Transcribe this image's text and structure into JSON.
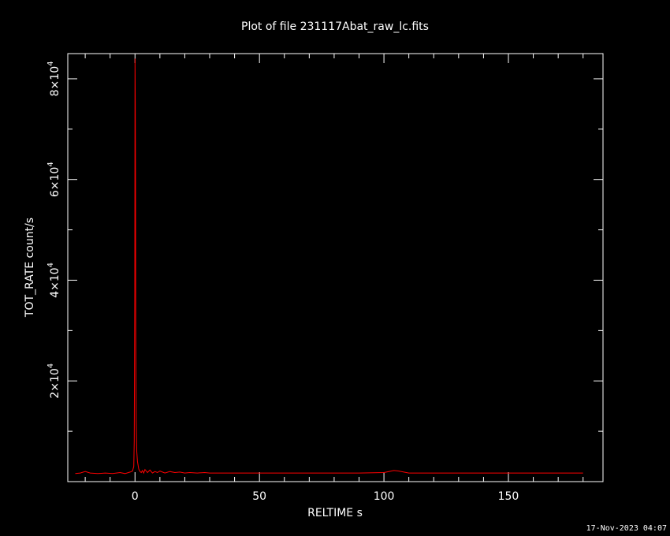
{
  "chart_data": {
    "type": "line",
    "title": "Plot of file 231117Abat_raw_lc.fits",
    "xlabel": "RELTIME   s",
    "ylabel": "TOT_RATE   count/s",
    "xlim": [
      -27,
      188
    ],
    "ylim": [
      0,
      85000
    ],
    "x_ticks": [
      {
        "value": 0,
        "label": "0"
      },
      {
        "value": 50,
        "label": "50"
      },
      {
        "value": 100,
        "label": "100"
      },
      {
        "value": 150,
        "label": "150"
      }
    ],
    "y_ticks": [
      {
        "value": 20000,
        "mant": "2",
        "times": "×10",
        "exp": "4"
      },
      {
        "value": 40000,
        "mant": "4",
        "times": "×10",
        "exp": "4"
      },
      {
        "value": 60000,
        "mant": "6",
        "times": "×10",
        "exp": "4"
      },
      {
        "value": 80000,
        "mant": "8",
        "times": "×10",
        "exp": "4"
      }
    ],
    "series": [
      {
        "color": "#ff0000",
        "x": [
          -24,
          -22,
          -20,
          -18,
          -15,
          -12,
          -9,
          -6,
          -4,
          -2,
          -1,
          -0.5,
          -0.3,
          -0.1,
          0,
          0.1,
          0.2,
          0.3,
          0.5,
          0.7,
          1,
          1.5,
          2,
          2.5,
          3,
          3.5,
          4,
          5,
          6,
          7,
          8,
          9,
          10,
          12,
          14,
          16,
          18,
          20,
          22,
          25,
          28,
          30,
          33,
          40,
          50,
          60,
          70,
          80,
          90,
          100,
          102,
          104,
          106,
          108,
          110,
          120,
          130,
          140,
          150,
          160,
          170,
          180
        ],
        "y": [
          1600,
          1700,
          2000,
          1700,
          1600,
          1700,
          1600,
          1800,
          1600,
          1900,
          2100,
          3000,
          8000,
          38000,
          84000,
          75000,
          60000,
          30000,
          12000,
          6000,
          4000,
          2500,
          2000,
          1800,
          2200,
          1700,
          2400,
          1800,
          2300,
          1700,
          2000,
          1800,
          2100,
          1700,
          2000,
          1800,
          1900,
          1700,
          1800,
          1700,
          1800,
          1700,
          1700,
          1700,
          1700,
          1700,
          1700,
          1700,
          1700,
          1800,
          2000,
          2200,
          2100,
          1900,
          1700,
          1700,
          1700,
          1700,
          1700,
          1700,
          1700,
          1700
        ]
      }
    ]
  },
  "timestamp": "17-Nov-2023 04:07"
}
